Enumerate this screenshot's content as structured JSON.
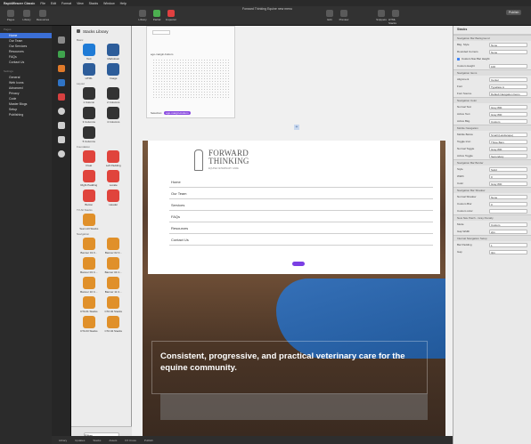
{
  "menubar": {
    "app": "RapidWeaver Classic",
    "items": [
      "File",
      "Edit",
      "Format",
      "View",
      "Stacks",
      "Window",
      "Help"
    ]
  },
  "window": {
    "title": "Forward Thinking Equine new menu"
  },
  "toolbar": {
    "left": [
      {
        "label": "Pages",
        "icon": "sidebar-icon"
      },
      {
        "label": "Library",
        "icon": "library-icon"
      },
      {
        "label": "Resources",
        "icon": "folder-icon"
      }
    ],
    "center": [
      {
        "label": "Library",
        "icon": "stack-icon"
      },
      {
        "label": "Partial",
        "icon": "partial-icon"
      },
      {
        "label": "Inspector",
        "icon": "inspector-icon"
      }
    ],
    "right": [
      {
        "label": "Edit",
        "icon": "edit-icon"
      },
      {
        "label": "Preview",
        "icon": "eye-icon"
      }
    ],
    "far_right": [
      {
        "label": "Snippets",
        "icon": "snippets-icon"
      },
      {
        "label": "HTML Stacks",
        "icon": "html-icon"
      },
      {
        "label": "Publish",
        "icon": "cloud-icon"
      }
    ]
  },
  "sidebar": {
    "pages_label": "Pages",
    "pages": [
      "Home",
      "Our Team",
      "Our Services",
      "Resources",
      "FAQs",
      "Contact Us"
    ],
    "settings_label": "Settings",
    "settings": [
      "General",
      "Web Icons",
      "Advanced",
      "Privacy",
      "Code",
      "Master Blogs",
      "Setup",
      "Publishing"
    ]
  },
  "library": {
    "title": "Stacks Library",
    "basic_label": "Basic",
    "basic": [
      "Text",
      "Markdown",
      "HTML",
      "Image"
    ],
    "layout_label": "Layout",
    "layout": [
      "1 Column",
      "2 Columns",
      "3 Columns",
      "4 Columns",
      "5 Columns"
    ],
    "foundation_label": "Foundation",
    "foundation": [
      "Float",
      "Left Padding",
      "Right Padding",
      "Locale",
      "Button",
      "Header"
    ],
    "item2_label": "TV All Stacks",
    "item2": "Team All Stacks",
    "bottom_label": "Navigation",
    "bottom": [
      "Banner 01 F...",
      "Banner 02 F...",
      "Banner 03 C...",
      "Banner 04 C...",
      "Banner 10 C...",
      "Banner 11 C...",
      "CTA 01 Stacks",
      "CTA 02 Stacks",
      "CTA 03 Stacks",
      "CTA 04 Stacks"
    ],
    "filter_placeholder": "Filter"
  },
  "canvas": {
    "top_stack_label": "ego-margin-bottom",
    "selection_label": "Selection:",
    "selection_value": "ego-margin-bottom",
    "logo_line1": "FORWARD",
    "logo_line2": "THINKING",
    "logo_sub": "EQUINE VETERINARY CARE",
    "nav_items": [
      "Home",
      "Our Team",
      "Services",
      "FAQs",
      "Resources",
      "Contact Us"
    ],
    "tagline": "Consistent, progressive, and practical veterinary care for the equine community."
  },
  "bottom_bar": {
    "items": [
      "Library",
      "Updates",
      "Stacks",
      "Assets",
      "FX Cross",
      "Publish"
    ]
  },
  "inspector": {
    "title": "Stacks",
    "sections": [
      {
        "label": "Navigation Bar Background",
        "rows": [
          {
            "k": "Bkg. Style",
            "v": "None"
          },
          {
            "k": "Rounded Corners",
            "v": "None"
          },
          {
            "k": "Custom Nav Bar Height",
            "v": ""
          },
          {
            "k": "Custom Height",
            "v": "100"
          }
        ]
      },
      {
        "label": "Navigation Items",
        "rows": [
          {
            "k": "Alignment",
            "v": "Center"
          },
          {
            "k": "Font",
            "v": "Typeface A"
          },
          {
            "k": "Font Source",
            "v": "Default Navigation Items"
          }
        ]
      },
      {
        "label": "Navigation Color",
        "rows": [
          {
            "k": "Normal Text",
            "v": "Grey 800"
          },
          {
            "k": "Active Text",
            "v": "Gray 800"
          },
          {
            "k": "Active Bkg.",
            "v": "Custom"
          }
        ]
      },
      {
        "label": "Mobile Navigation",
        "rows": [
          {
            "k": "Mobile Below",
            "v": "Small (Landscape)"
          },
          {
            "k": "Toggle Icon",
            "v": "Three Bars"
          },
          {
            "k": "Normal Toggle",
            "v": "Gray 800"
          },
          {
            "k": "Active Toggle",
            "v": "Secondary"
          }
        ]
      },
      {
        "label": "Navigation Bar Border",
        "rows": [
          {
            "k": "Style",
            "v": "Solid"
          },
          {
            "k": "Width",
            "v": "0"
          },
          {
            "k": "Color",
            "v": "Gray 800"
          }
        ]
      },
      {
        "label": "Navigation Bar Shadow",
        "rows": [
          {
            "k": "Normal Shadow",
            "v": "None"
          },
          {
            "k": "Custom Blur",
            "v": "0"
          },
          {
            "k": "Custom color",
            "v": ""
          }
        ]
      },
      {
        "label": "New Nav Patch - Gray Penalty",
        "rows": [
          {
            "k": "Mode",
            "v": "Custom"
          },
          {
            "k": "Gap Width",
            "v": "2px"
          }
        ]
      },
      {
        "label": "Internal Navigation Setup",
        "rows": [
          {
            "k": "Bar Padding",
            "v": "1"
          },
          {
            "k": "Gap",
            "v": "3px"
          }
        ]
      }
    ]
  }
}
